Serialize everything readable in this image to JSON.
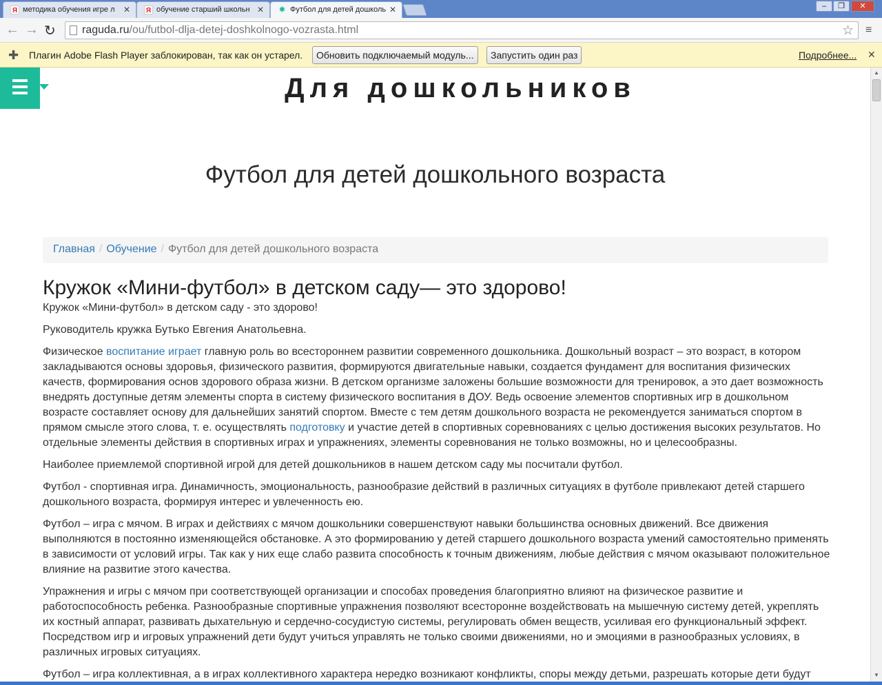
{
  "browser": {
    "tabs": [
      {
        "title": "методика обучения игре л",
        "favicon": "yandex-icon"
      },
      {
        "title": "обучение старший школьн",
        "favicon": "yandex-icon"
      },
      {
        "title": "Футбол для детей дошколь",
        "favicon": "raguda-icon",
        "active": true
      }
    ],
    "url_host": "raguda.ru",
    "url_path": "/ou/futbol-dlja-detej-doshkolnogo-vozrasta.html",
    "infobar": {
      "message": "Плагин Adobe Flash Player заблокирован, так как он устарел.",
      "update_label": "Обновить подключаемый модуль...",
      "run_once_label": "Запустить один раз",
      "more_label": "Подробнее..."
    }
  },
  "site": {
    "title": "Для дошкольников",
    "accent": "#1dbb9a"
  },
  "page": {
    "heading": "Футбол для детей дошкольного возраста",
    "breadcrumb": [
      "Главная",
      "Обучение",
      "Футбол для детей дошкольного возраста"
    ]
  },
  "article": {
    "title": "Кружок «Мини-футбол» в детском саду— это здорово!",
    "subtitle": "Кружок «Мини-футбол» в детском саду - это здорово!",
    "p1": "Руководитель кружка Бутько Евгения Анатольевна.",
    "p2_a": "Физическое ",
    "p2_link1": "воспитание играет",
    "p2_b": " главную роль во всестороннем развитии современного дошкольника. Дошкольный возраст – это возраст, в котором закладываются основы здоровья, физического развития, формируются двигательные навыки, создается фундамент для воспитания физических качеств, формирования основ здорового образа жизни. В детском организме заложены большие возможности для тренировок, а это дает возможность внедрять доступные детям элементы спорта в систему физического воспитания в ДОУ. Ведь освоение элементов спортивных игр в дошкольном возрасте составляет основу для дальнейших занятий спортом. Вместе с тем детям дошкольного возраста не рекомендуется заниматься спортом в прямом смысле этого слова, т. е. осуществлять ",
    "p2_link2": "подготовку",
    "p2_c": " и участие детей в спортивных соревнованиях с целью достижения высоких результатов. Но отдельные элементы действия в спортивных играх и упражнениях, элементы соревнования не только возможны, но и целесообразны.",
    "p3": "Наиболее приемлемой спортивной игрой для детей дошкольников в нашем детском саду мы посчитали футбол.",
    "p4": "Футбол - спортивная игра. Динамичность, эмоциональность, разнообразие действий в различных ситуациях в футболе привлекают детей старшего дошкольного возраста, формируя интерес и увлеченность ею.",
    "p5": "Футбол – игра с мячом. В играх и действиях с мячом дошкольники совершенствуют навыки большинства основных движений. Все движения выполняются в постоянно изменяющейся обстановке. А это формированию у детей старшего дошкольного возраста умений самостоятельно применять в зависимости от условий игры. Так как у них еще слабо развита способность к точным движениям, любые действия с мячом оказывают положительное влияние на развитие этого качества.",
    "p6": "Упражнения и игры с мячом при соответствующей организации и способах проведения благоприятно влияют на физическое развитие и работоспособность ребенка. Разнообразные спортивные упражнения позволяют всесторонне воздействовать на мышечную систему детей, укреплять их костный аппарат, развивать дыхательную и сердечно-сосудистую системы, регулировать обмен веществ, усиливая его функциональный эффект. Посредством игр и игровых упражнений дети будут учиться управлять не только своими движениями, но и эмоциями в разнообразных условиях, в различных игровых ситуациях.",
    "p7": "Футбол – игра коллективная, а в играх коллективного характера нередко возникают конфликты, споры между детьми, разрешать которые дети будут учиться также в ходе игр."
  }
}
